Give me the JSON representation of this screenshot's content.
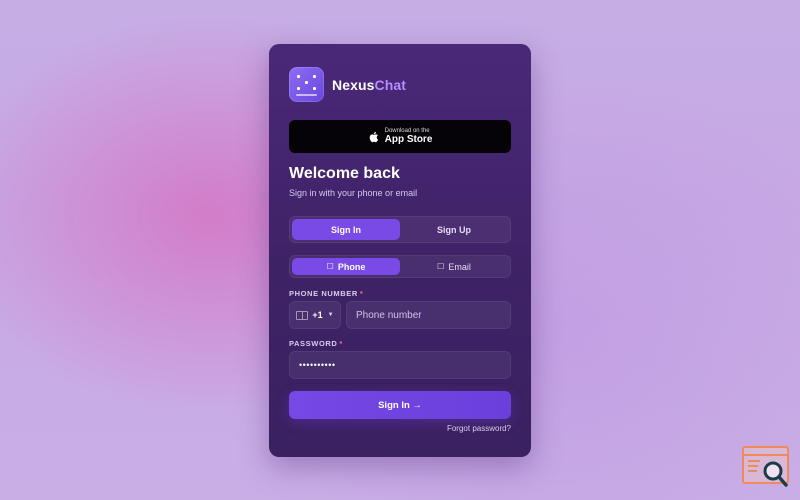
{
  "brand": {
    "name_main": "Nexus",
    "name_accent": "Chat",
    "logo_icon": "grid-dots-icon"
  },
  "appstore": {
    "small": "Download on the",
    "big": "App Store",
    "icon": "apple-icon"
  },
  "header": {
    "title": "Welcome back",
    "subtitle": "Sign in with your phone or email"
  },
  "auth_tabs": [
    {
      "label": "Sign In",
      "active": true
    },
    {
      "label": "Sign Up",
      "active": false
    }
  ],
  "method_tabs": [
    {
      "label": "Phone",
      "icon": "phone-icon",
      "active": true
    },
    {
      "label": "Email",
      "icon": "email-icon",
      "active": false
    }
  ],
  "phone": {
    "label": "PHONE NUMBER",
    "required_mark": "*",
    "country_code": "+1",
    "placeholder": "Phone number",
    "value": ""
  },
  "password": {
    "label": "PASSWORD",
    "required_mark": "*",
    "value": "••••••••••"
  },
  "submit_label": "Sign In →",
  "forgot_label": "Forgot password?",
  "colors": {
    "accent": "#7a4ae6",
    "card": "#3e2266",
    "brand_accent": "#b68cff",
    "required": "#ff6a8a"
  }
}
